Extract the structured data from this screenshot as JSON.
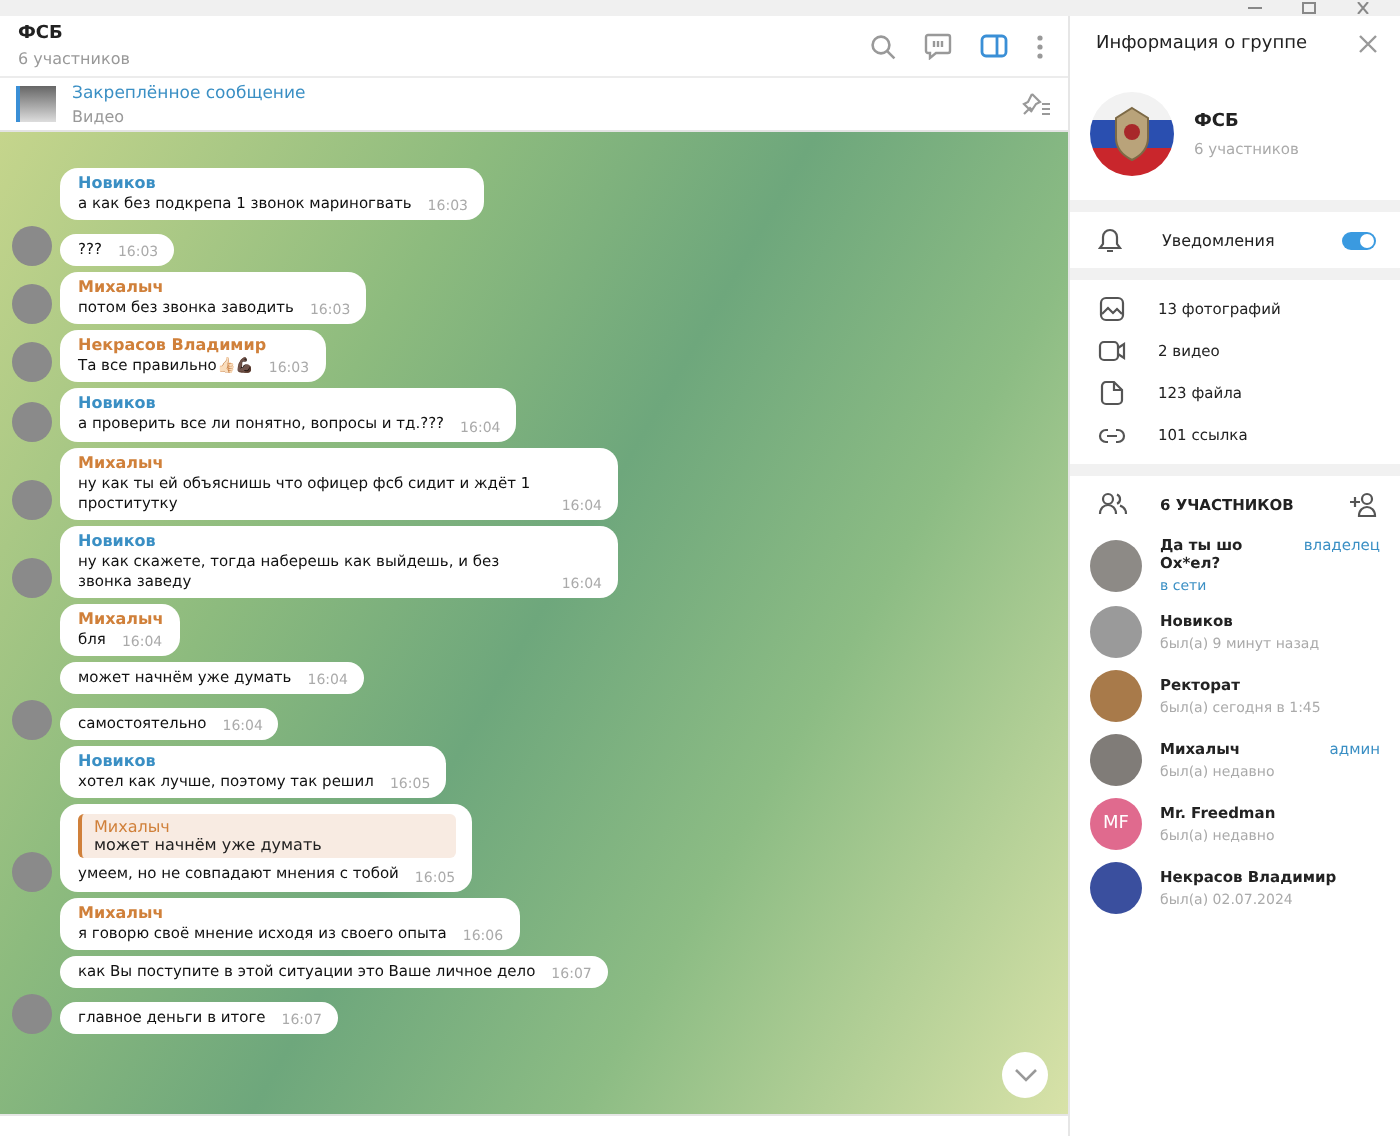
{
  "chat": {
    "title": "ФСБ",
    "subtitle": "6 участников"
  },
  "pinned": {
    "label": "Закреплённое сообщение",
    "text": "Видео"
  },
  "messages": [
    {
      "sender": "Новиков",
      "color": "#3a8fc4",
      "text": "а как без подкрепа 1 звонок мариногвать",
      "time": "16:03",
      "avatar": false
    },
    {
      "text": "???",
      "time": "16:03",
      "avatar": true
    },
    {
      "sender": "Михалыч",
      "color": "#d0803a",
      "text": "потом без звонка заводить",
      "time": "16:03",
      "avatar": true
    },
    {
      "sender": "Некрасов Владимир",
      "color": "#d0803a",
      "text": "Та все правильно👍🏻💪🏿",
      "time": "16:03",
      "avatar": true
    },
    {
      "sender": "Новиков",
      "color": "#3a8fc4",
      "text": "а проверить все ли понятно, вопросы и тд.???",
      "time": "16:04",
      "avatar": true
    },
    {
      "sender": "Михалыч",
      "color": "#d0803a",
      "text": "ну как ты ей объяснишь что офицер фсб сидит и ждёт 1 проститутку",
      "time": "16:04",
      "avatar": true
    },
    {
      "sender": "Новиков",
      "color": "#3a8fc4",
      "text": "ну как скажете, тогда наберешь как выйдешь, и без звонка заведу",
      "time": "16:04",
      "avatar": true
    },
    {
      "sender": "Михалыч",
      "color": "#d0803a",
      "text": "бля",
      "time": "16:04",
      "avatar": false
    },
    {
      "text": "может начнём уже думать",
      "time": "16:04",
      "avatar": false
    },
    {
      "text": "самостоятельно",
      "time": "16:04",
      "avatar": true
    },
    {
      "sender": "Новиков",
      "color": "#3a8fc4",
      "text": "хотел как лучше, поэтому так решил",
      "time": "16:05",
      "avatar": false
    },
    {
      "reply": {
        "sender": "Михалыч",
        "text": "может начнём уже думать"
      },
      "text": "умеем, но не совпадают мнения с тобой",
      "time": "16:05",
      "avatar": true
    },
    {
      "sender": "Михалыч",
      "color": "#d0803a",
      "text": "я говорю своё мнение исходя из своего опыта",
      "time": "16:06",
      "avatar": false
    },
    {
      "text": "как Вы поступите в этой ситуации это Ваше личное дело",
      "time": "16:07",
      "avatar": false
    },
    {
      "text": "главное деньги в итоге",
      "time": "16:07",
      "avatar": true
    }
  ],
  "info": {
    "title": "Информация о группе",
    "name": "ФСБ",
    "subtitle": "6 участников",
    "notifications": {
      "label": "Уведомления",
      "on": true
    },
    "media": [
      {
        "kind": "photo",
        "label": "13 фотографий"
      },
      {
        "kind": "video",
        "label": "2 видео"
      },
      {
        "kind": "file",
        "label": "123 файла"
      },
      {
        "kind": "link",
        "label": "101 ссылка"
      }
    ],
    "members_title": "6 УЧАСТНИКОВ",
    "members": [
      {
        "name": "Да ты шо Ох*ел?",
        "status": "в сети",
        "online": true,
        "role": "владелец"
      },
      {
        "name": "Новиков",
        "status": "был(а) 9 минут назад",
        "online": false
      },
      {
        "name": "Ректорат",
        "status": "был(а) сегодня в 1:45",
        "online": false
      },
      {
        "name": "Михалыч",
        "status": "был(а) недавно",
        "online": false,
        "role": "админ"
      },
      {
        "name": "Mr. Freedman",
        "status": "был(а) недавно",
        "online": false,
        "initials": "MF"
      },
      {
        "name": "Некрасов Владимир",
        "status": "был(а) 02.07.2024",
        "online": false
      }
    ]
  }
}
